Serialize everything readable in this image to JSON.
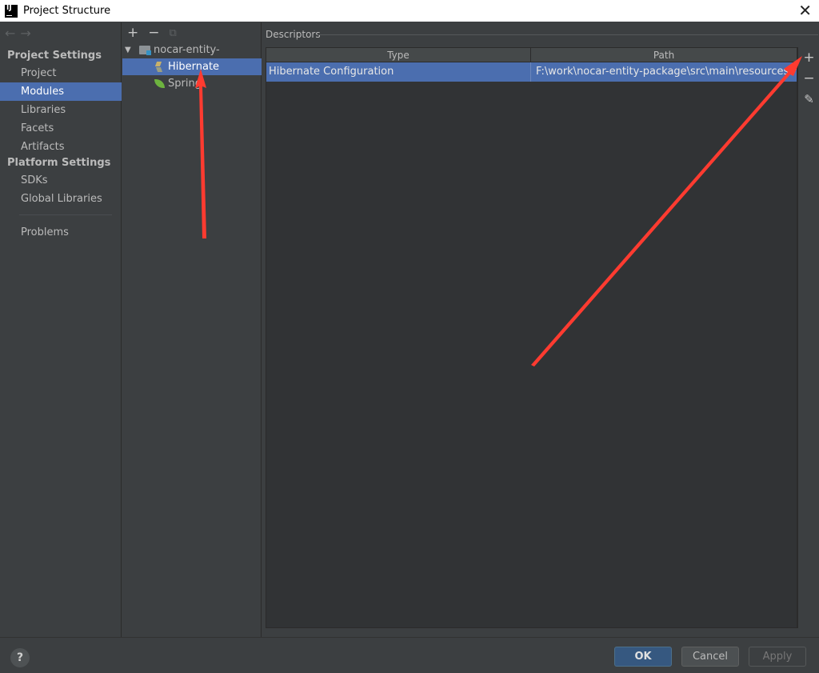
{
  "window": {
    "title": "Project Structure",
    "app_icon_text": "IJ",
    "close_glyph": "✕"
  },
  "nav": {
    "back_glyph": "←",
    "forward_glyph": "→"
  },
  "sidebar": {
    "project_settings_title": "Project Settings",
    "platform_settings_title": "Platform Settings",
    "items": [
      {
        "label": "Project"
      },
      {
        "label": "Modules",
        "selected": true
      },
      {
        "label": "Libraries"
      },
      {
        "label": "Facets"
      },
      {
        "label": "Artifacts"
      },
      {
        "label": "SDKs"
      },
      {
        "label": "Global Libraries"
      },
      {
        "label": "Problems"
      }
    ]
  },
  "tree": {
    "toolbar": {
      "add": "+",
      "remove": "−",
      "copy": "⧉"
    },
    "root": {
      "label": "nocar-entity-package",
      "expanded_glyph": "▼"
    },
    "children": [
      {
        "label": "Hibernate",
        "icon": "hibernate-icon",
        "selected": true
      },
      {
        "label": "Spring",
        "icon": "spring-leaf-icon"
      }
    ]
  },
  "descriptors": {
    "title": "Descriptors",
    "columns": {
      "type": "Type",
      "path": "Path"
    },
    "rows": [
      {
        "type": "Hibernate Configuration",
        "path": "F:\\work\\nocar-entity-package\\src\\main\\resources\\hibe",
        "selected": true
      }
    ],
    "tools": {
      "add": "+",
      "remove": "−",
      "edit": "✎"
    }
  },
  "footer": {
    "help": "?",
    "ok": "OK",
    "cancel": "Cancel",
    "apply": "Apply"
  },
  "colors": {
    "background": "#3c3f41",
    "selection": "#4b6eaf",
    "annotation_arrow": "#ff3b30",
    "ok_button": "#365880"
  }
}
